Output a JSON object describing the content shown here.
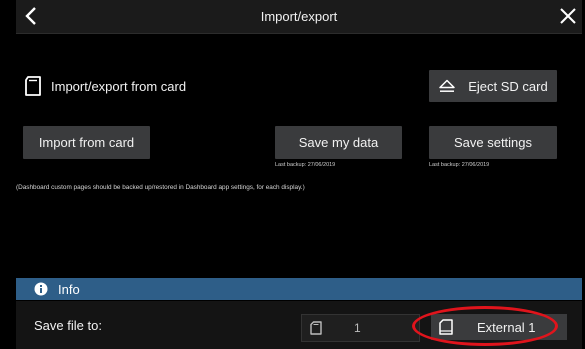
{
  "window": {
    "title": "Import/export"
  },
  "section": {
    "label": "Import/export from card"
  },
  "buttons": {
    "eject": "Eject SD card",
    "import": "Import from card",
    "save_data": "Save my data",
    "save_settings": "Save settings"
  },
  "notes": {
    "save_data_backup": "Last backup: 27/06/2019",
    "save_settings_backup": "Last backup: 27/06/2019",
    "dashboard_hint": "(Dashboard custom pages should be backed up/restored in Dashboard app settings, for each display.)"
  },
  "info": {
    "label": "Info"
  },
  "save_file": {
    "label": "Save file to:",
    "options": [
      {
        "label": "1",
        "selected": false
      },
      {
        "label": "External 1",
        "selected": true
      }
    ]
  },
  "colors": {
    "background": "#000000",
    "button": "#3a3b3d",
    "info_bar": "#2e5e88",
    "highlight": "#e0141c"
  },
  "icons": {
    "back": "chevron-left-icon",
    "close": "close-icon",
    "sd_card": "sd-card-icon",
    "eject": "eject-icon",
    "info": "info-icon",
    "card": "card-icon"
  }
}
